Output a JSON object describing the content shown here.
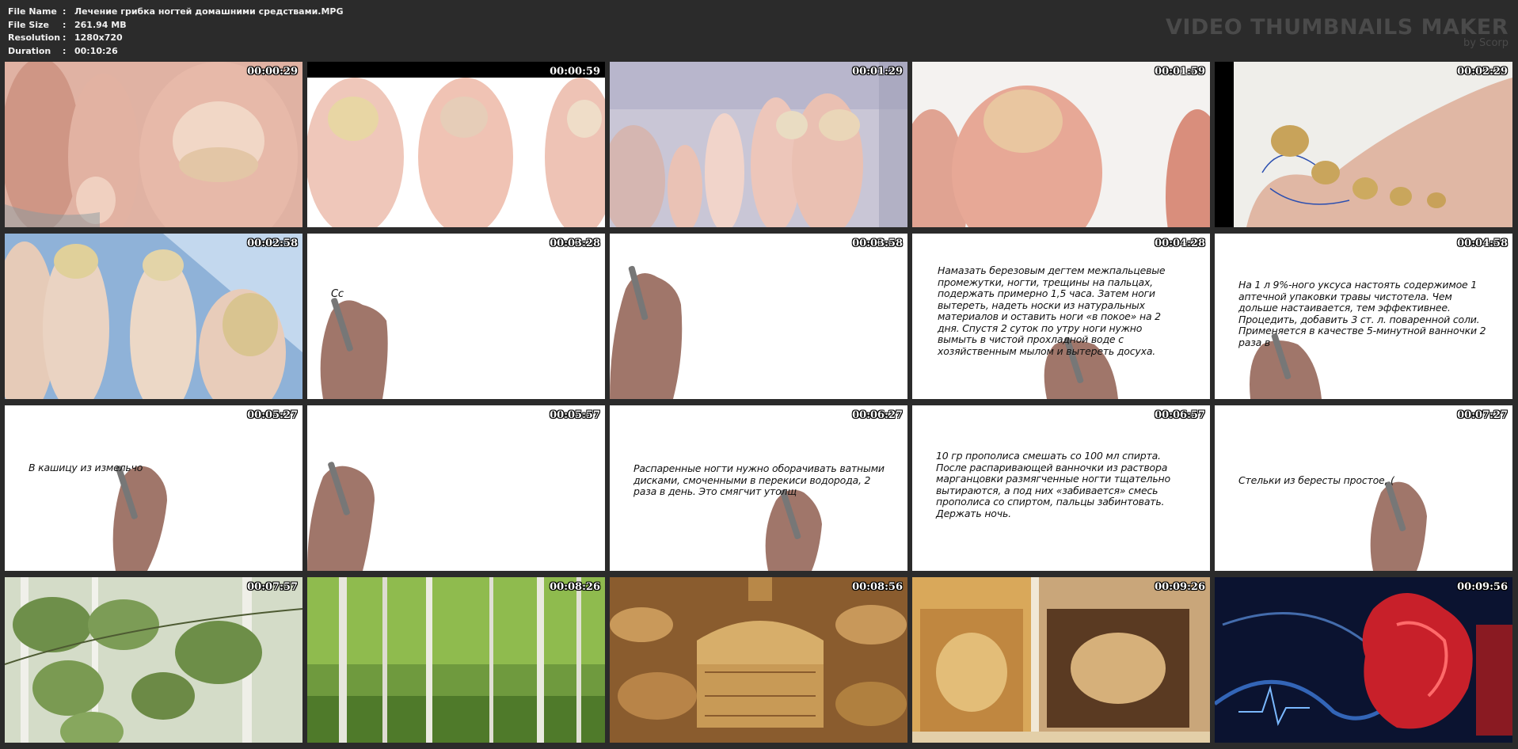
{
  "file_info": {
    "rows": [
      {
        "label": "File Name",
        "sep": ":",
        "value": "Лечение грибка ногтей домашними средствами.MPG"
      },
      {
        "label": "File Size",
        "sep": ":",
        "value": "261.94 MB"
      },
      {
        "label": "Resolution",
        "sep": ":",
        "value": "1280x720"
      },
      {
        "label": "Duration",
        "sep": ":",
        "value": "00:10:26"
      }
    ]
  },
  "brand": {
    "title": "VIDEO THUMBNAILS MAKER",
    "subtitle": "by Scorp",
    "color": "#4a4a4a"
  },
  "thumbnails": [
    {
      "time": "00:00:29",
      "scene": "photo-toe-closeup"
    },
    {
      "time": "00:00:59",
      "scene": "photo-three-toes"
    },
    {
      "time": "00:01:29",
      "scene": "photo-toes-faded"
    },
    {
      "time": "00:01:59",
      "scene": "photo-big-toe"
    },
    {
      "time": "00:02:29",
      "scene": "photo-foot-side"
    },
    {
      "time": "00:02:58",
      "scene": "photo-toes-blue"
    },
    {
      "time": "00:03:28",
      "scene": "whiteboard-hand",
      "text": "Сс"
    },
    {
      "time": "00:03:58",
      "scene": "whiteboard-hand",
      "text": ""
    },
    {
      "time": "00:04:28",
      "scene": "whiteboard-text",
      "text": "Намазать березовым дегтем межпальцевые промежутки, ногти, трещины на пальцах, подержать примерно 1,5 часа. Затем ноги вытереть, надеть носки из натуральных материалов и оставить ноги «в покое» на 2 дня. Спустя 2 суток по утру ноги нужно вымыть в чистой прохладной воде с хозяйственным мылом и вытереть досуха."
    },
    {
      "time": "00:04:58",
      "scene": "whiteboard-text",
      "text": "На 1 л 9%-ного уксуса настоять содержимое 1 аптечной упаковки травы чистотела. Чем дольше настаивается, тем эффективнее. Процедить, добавить 3 ст. л. поваренной соли. Применяется в качестве 5-минутной ванночки 2 раза в"
    },
    {
      "time": "00:05:27",
      "scene": "whiteboard-text",
      "text": "В кашицу из измельчо"
    },
    {
      "time": "00:05:57",
      "scene": "whiteboard-hand",
      "text": ""
    },
    {
      "time": "00:06:27",
      "scene": "whiteboard-text",
      "text": "Распаренные ногти нужно оборачивать ватными дисками, смоченными в перекиси водорода, 2 раза в день. Это смягчит утолщ"
    },
    {
      "time": "00:06:57",
      "scene": "whiteboard-text",
      "text": "10 гр прополиса смешать со 100 мл спирта. После распаривающей ванночки из раствора марганцовки размягченные ногти тщательно вытираются, а под них «забивается» смесь прополиса со спиртом, пальцы забинтовать. Держать ночь."
    },
    {
      "time": "00:07:27",
      "scene": "whiteboard-text",
      "text": "Стельки из бересты простое, ("
    },
    {
      "time": "00:07:57",
      "scene": "photo-birch-leaves"
    },
    {
      "time": "00:08:26",
      "scene": "photo-birch-forest"
    },
    {
      "time": "00:08:56",
      "scene": "photo-birchbark-crafts"
    },
    {
      "time": "00:09:26",
      "scene": "photo-birchbark-jars"
    },
    {
      "time": "00:09:56",
      "scene": "photo-heart"
    }
  ]
}
